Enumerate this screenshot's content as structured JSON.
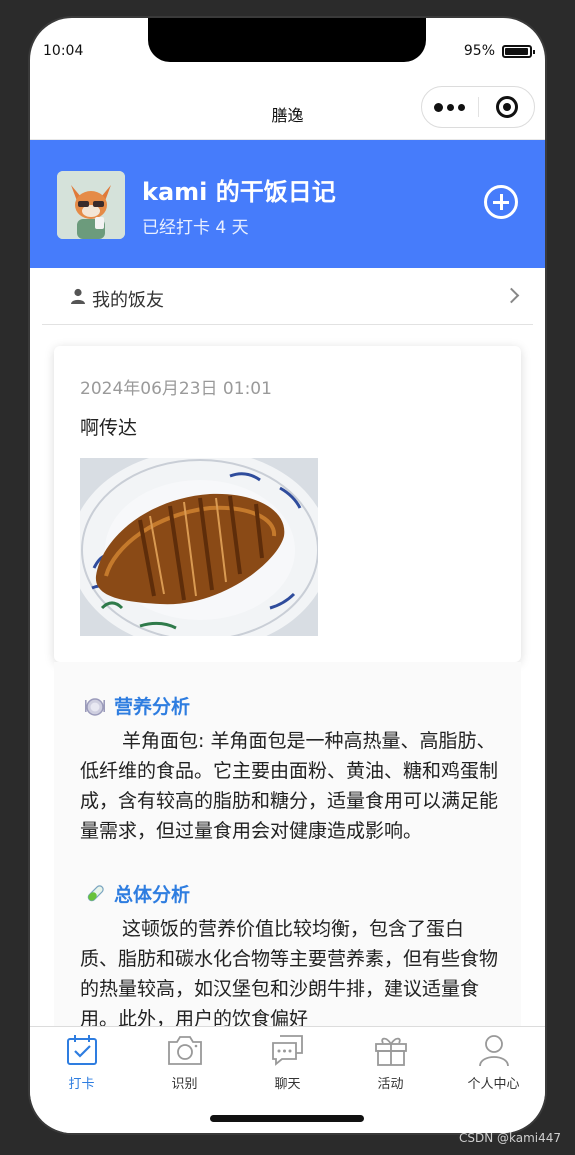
{
  "status_bar": {
    "time": "10:04",
    "battery_text": "95%",
    "battery_level": 0.95
  },
  "nav": {
    "title": "膳逸"
  },
  "header": {
    "title": "kami 的干饭日记",
    "subtitle": "已经打卡 4 天"
  },
  "friends": {
    "label": "我的饭友"
  },
  "diary": {
    "date": "2024年06月23日 01:01",
    "text": "啊传达"
  },
  "nutrition": {
    "title": "营养分析",
    "body": "羊角面包: 羊角面包是一种高热量、高脂肪、低纤维的食品。它主要由面粉、黄油、糖和鸡蛋制成，含有较高的脂肪和糖分，适量食用可以满足能量需求，但过量食用会对健康造成影响。"
  },
  "overall": {
    "title": "总体分析",
    "body": "这顿饭的营养价值比较均衡，包含了蛋白质、脂肪和碳水化合物等主要营养素，但有些食物的热量较高，如汉堡包和沙朗牛排，建议适量食用。此外，用户的饮食偏好"
  },
  "tabs": [
    {
      "label": "打卡",
      "icon": "calendar-check-icon",
      "active": true
    },
    {
      "label": "识别",
      "icon": "camera-icon",
      "active": false
    },
    {
      "label": "聊天",
      "icon": "chat-icon",
      "active": false
    },
    {
      "label": "活动",
      "icon": "gift-icon",
      "active": false
    },
    {
      "label": "个人中心",
      "icon": "person-icon",
      "active": false
    }
  ],
  "watermark": "CSDN @kami447",
  "colors": {
    "primary": "#467cfb",
    "accent": "#2e7de0"
  }
}
